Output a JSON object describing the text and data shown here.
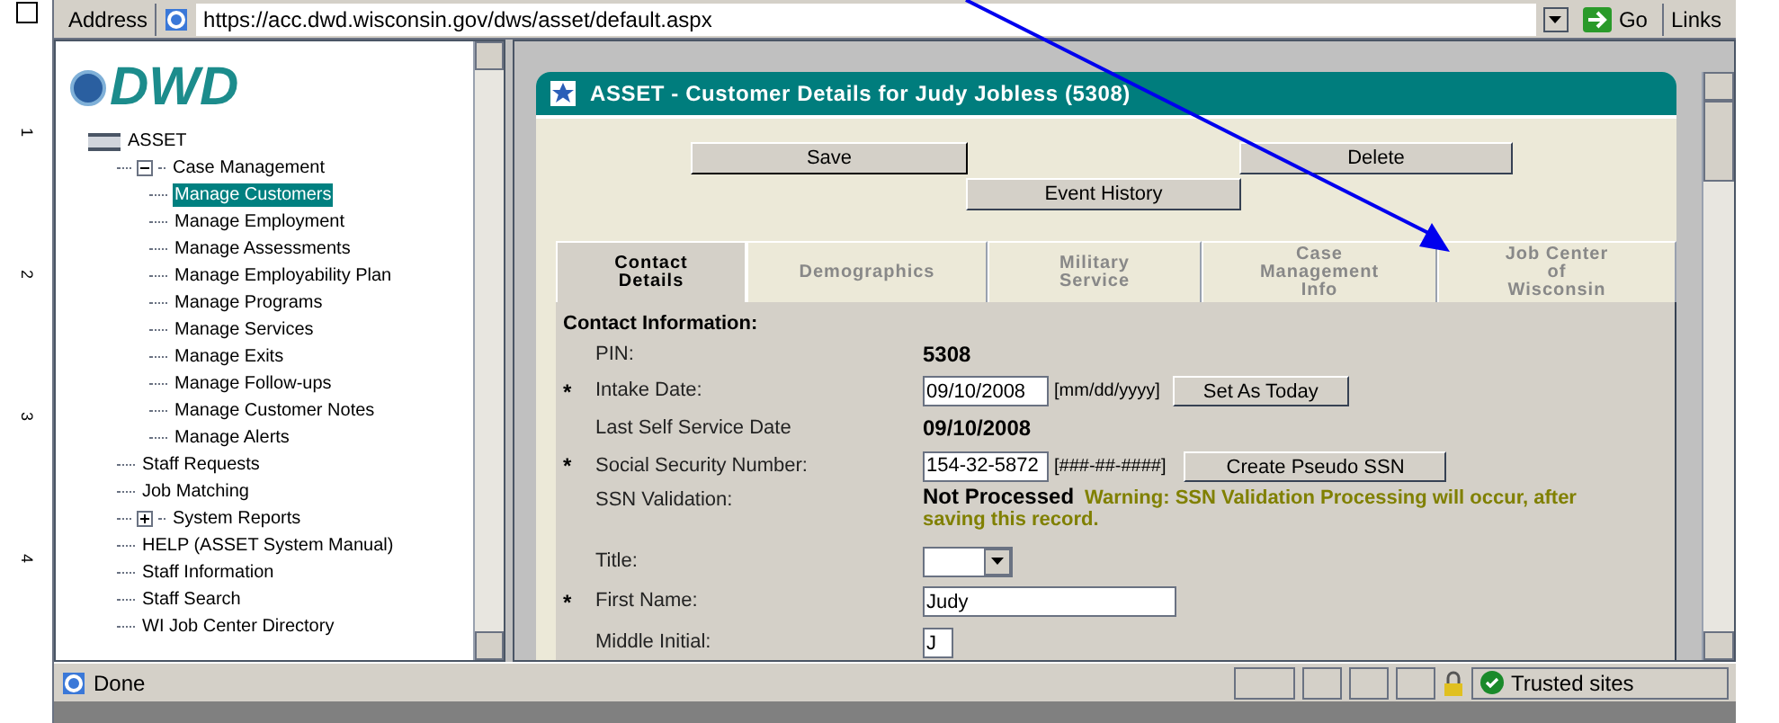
{
  "ruler": {
    "numbers": [
      "1",
      "2",
      "3",
      "4"
    ]
  },
  "address_bar": {
    "label": "Address",
    "url": "https://acc.dwd.wisconsin.gov/dws/asset/default.aspx",
    "go": "Go",
    "links": "Links"
  },
  "sidebar": {
    "logo": "DWD",
    "tree": [
      {
        "label": "ASSET",
        "kind": "root",
        "selected": false,
        "children": [
          {
            "label": "Case Management",
            "kind": "folder",
            "expanded": true,
            "selected": false,
            "children": [
              {
                "label": "Manage Customers",
                "kind": "leaf",
                "selected": true
              },
              {
                "label": "Manage Employment",
                "kind": "leaf",
                "selected": false
              },
              {
                "label": "Manage Assessments",
                "kind": "leaf",
                "selected": false
              },
              {
                "label": "Manage Employability Plan",
                "kind": "leaf",
                "selected": false
              },
              {
                "label": "Manage Programs",
                "kind": "leaf",
                "selected": false
              },
              {
                "label": "Manage Services",
                "kind": "leaf",
                "selected": false
              },
              {
                "label": "Manage Exits",
                "kind": "leaf",
                "selected": false
              },
              {
                "label": "Manage Follow-ups",
                "kind": "leaf",
                "selected": false
              },
              {
                "label": "Manage Customer Notes",
                "kind": "leaf",
                "selected": false
              },
              {
                "label": "Manage Alerts",
                "kind": "leaf",
                "selected": false
              }
            ]
          },
          {
            "label": "Staff Requests",
            "kind": "leaf",
            "selected": false
          },
          {
            "label": "Job Matching",
            "kind": "leaf",
            "selected": false
          },
          {
            "label": "System Reports",
            "kind": "folder",
            "expanded": false,
            "selected": false
          },
          {
            "label": "HELP (ASSET System Manual)",
            "kind": "leaf",
            "selected": false
          },
          {
            "label": "Staff Information",
            "kind": "leaf",
            "selected": false
          },
          {
            "label": "Staff Search",
            "kind": "leaf",
            "selected": false
          },
          {
            "label": "WI Job Center Directory",
            "kind": "leaf",
            "selected": false
          }
        ]
      }
    ]
  },
  "panel": {
    "title": "ASSET - Customer Details for Judy Jobless (5308)",
    "buttons": {
      "save": "Save",
      "delete": "Delete",
      "event_history": "Event History"
    },
    "tabs": [
      {
        "label": "Contact Details",
        "selected": true
      },
      {
        "label": "Demographics",
        "selected": false
      },
      {
        "label": "Military Service",
        "selected": false
      },
      {
        "label": "Case Management Info",
        "selected": false
      },
      {
        "label": "Job Center of Wisconsin",
        "selected": false
      }
    ],
    "section_title": "Contact Information:",
    "fields": [
      {
        "kind": "static",
        "label": "PIN:",
        "value": "5308"
      },
      {
        "kind": "date",
        "mark": "*",
        "label": "Intake Date:",
        "value": "09/10/2008",
        "hint": "[mm/dd/yyyy]",
        "button": "Set As Today"
      },
      {
        "kind": "static",
        "label": "Last Self Service Date",
        "value": "09/10/2008"
      },
      {
        "kind": "ssn",
        "mark": "*",
        "label": "Social Security Number:",
        "value": "154-32-5872",
        "hint": "[###-##-####]",
        "button": "Create Pseudo SSN"
      },
      {
        "kind": "validation",
        "label": "SSN Validation:",
        "value": "Not Processed",
        "warning": "Warning: SSN Validation Processing will occur, after saving this record."
      },
      {
        "kind": "select",
        "label": "Title:"
      },
      {
        "kind": "name",
        "mark": "*",
        "label": "First Name:",
        "value": "Judy"
      },
      {
        "kind": "initial",
        "label": "Middle Initial:",
        "value": "J"
      }
    ]
  },
  "status_bar": {
    "text": "Done",
    "zone": "Trusted sites"
  }
}
